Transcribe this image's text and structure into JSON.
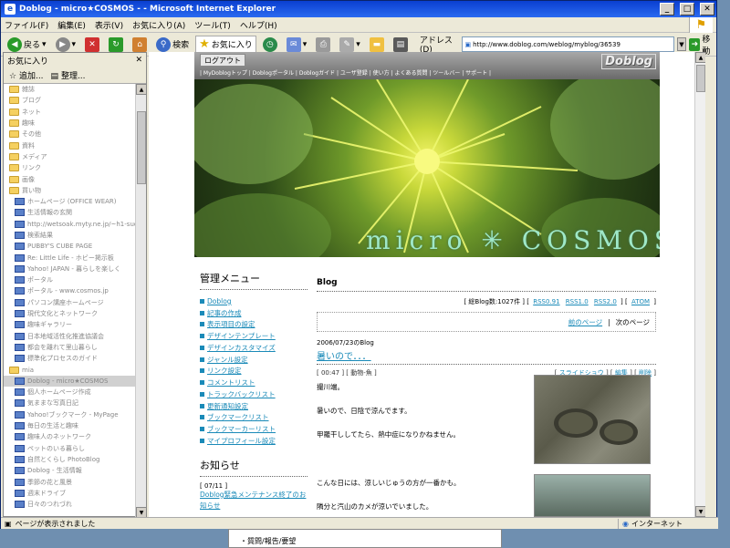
{
  "window": {
    "title": "Doblog - micro★COSMOS - - Microsoft Internet Explorer"
  },
  "menu": [
    "ファイル(F)",
    "編集(E)",
    "表示(V)",
    "お気に入り(A)",
    "ツール(T)",
    "ヘルプ(H)"
  ],
  "toolbar": {
    "back": "戻る",
    "search": "検索",
    "favorites": "お気に入り",
    "address_label": "アドレス(D)",
    "address": "http://www.doblog.com/weblog/myblog/36539",
    "go": "移動"
  },
  "favorites": {
    "title": "お気に入り",
    "add": "追加...",
    "organize": "整理...",
    "items": [
      {
        "t": "f",
        "label": "雑誌"
      },
      {
        "t": "f",
        "label": "ブログ"
      },
      {
        "t": "f",
        "label": "ネット"
      },
      {
        "t": "f",
        "label": "趣味"
      },
      {
        "t": "f",
        "label": "その他"
      },
      {
        "t": "f",
        "label": "資料"
      },
      {
        "t": "f",
        "label": "メディア"
      },
      {
        "t": "f",
        "label": "リンク"
      },
      {
        "t": "f",
        "label": "画像"
      },
      {
        "t": "f",
        "label": "買い物"
      },
      {
        "t": "p",
        "label": "ホームページ (OFFICE WEAR)"
      },
      {
        "t": "p",
        "label": "生活情報の玄関"
      },
      {
        "t": "p",
        "label": "http://wetsoak.myty.ne.jp/~h1-sud"
      },
      {
        "t": "p",
        "label": "検索結果"
      },
      {
        "t": "p",
        "label": "PUBBY'S CUBE PAGE"
      },
      {
        "t": "p",
        "label": "Re: Little Life - ホビー掲示板"
      },
      {
        "t": "p",
        "label": "Yahoo! JAPAN - 暮らしを楽しく"
      },
      {
        "t": "p",
        "label": "ポータル"
      },
      {
        "t": "p",
        "label": "ポータル - www.cosmos.jp"
      },
      {
        "t": "p",
        "label": "パソコン講座ホームページ"
      },
      {
        "t": "p",
        "label": "現代文化とネットワーク"
      },
      {
        "t": "p",
        "label": "趣味ギャラリー"
      },
      {
        "t": "p",
        "label": "日本地域活性化推進協議会"
      },
      {
        "t": "p",
        "label": "都会を離れて里山暮らし"
      },
      {
        "t": "p",
        "label": "標準化プロセスのガイド"
      },
      {
        "t": "f",
        "label": "mia"
      },
      {
        "t": "s",
        "label": "Doblog - micro★COSMOS"
      },
      {
        "t": "p",
        "label": "個人ホームページ作成"
      },
      {
        "t": "p",
        "label": "気ままな写真日記"
      },
      {
        "t": "p",
        "label": "Yahoo!ブックマーク - MyPage"
      },
      {
        "t": "p",
        "label": "毎日の生活と趣味"
      },
      {
        "t": "p",
        "label": "趣味人のネットワーク"
      },
      {
        "t": "p",
        "label": "ペットのいる暮らし"
      },
      {
        "t": "p",
        "label": "自然とくらし PhotoBlog"
      },
      {
        "t": "p",
        "label": "Doblog - 生活情報"
      },
      {
        "t": "p",
        "label": "季節の花と風景"
      },
      {
        "t": "p",
        "label": "週末ドライブ"
      },
      {
        "t": "p",
        "label": "日々のつれづれ"
      }
    ]
  },
  "page": {
    "logout": "ログアウト",
    "brand": "Doblog",
    "nav": "| MyDoblogトップ | Doblogポータル | Doblogガイド | ユーザ登録 | 使い方 | よくある質問 | ツールバー | サポート |",
    "blog_title": "micro ✳ COSMOS",
    "side": {
      "menu_title": "管理メニュー",
      "menu": [
        "Doblog",
        "記事の作成",
        "表示項目の設定",
        "デザインテンプレート",
        "デザインカスタマイズ",
        "ジャンル設定",
        "リンク設定",
        "コメントリスト",
        "トラックバックリスト",
        "更新通知設定",
        "ブックマークリスト",
        "ブックマーカーリスト",
        "マイプロフィール設定"
      ],
      "news_title": "お知らせ",
      "news_date": "[ 07/11 ]",
      "news_text": "Doblog緊急メンテナンス終了のお知らせ"
    },
    "main": {
      "heading": "Blog",
      "count": "[ 総Blog数:1027件 ] [",
      "rss": [
        "RSS0.91",
        "RSS1.0",
        "RSS2.0"
      ],
      "atom": "ATOM",
      "prev": "前のページ",
      "sep": "|",
      "next": "次のページ",
      "date": "2006/07/23のBlog",
      "title": "暑いので．．．",
      "meta_left": "[ 00:47 ] [ 動物-魚 ]",
      "slideshow": "スライドショウ",
      "edit": "編集",
      "delete": "削除",
      "lines": [
        "撮川端。",
        "暑いので、日陰で涼んでます。",
        "甲羅干ししてたら、熱中症になりかねません。",
        "こんな日には、涼しいじゅうの方が一番かも。",
        "隣分と汽山のカメが涼いでいました。"
      ]
    }
  },
  "status": {
    "text": "ページが表示されました",
    "zone": "インターネット"
  },
  "taskbar": {
    "text": "質問/報告/要望"
  }
}
